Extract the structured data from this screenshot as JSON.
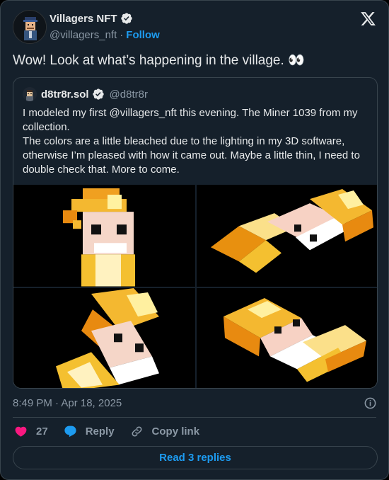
{
  "author": {
    "name": "Villagers NFT",
    "handle": "@villagers_nft",
    "separator": "·",
    "follow_label": "Follow"
  },
  "tweet": {
    "text": "Wow! Look at what’s happening in the village. 👀",
    "timestamp": "8:49 PM · Apr 18, 2025"
  },
  "quoted": {
    "name": "d8tr8r.sol",
    "handle": "@d8tr8r",
    "text": "I modeled my first @villagers_nft this evening. The Miner 1039 from my collection.\nThe colors are a little bleached due to the lighting in my 3D software, otherwise I’m pleased with how it came out. Maybe a little thin, I need to double check that. More to come."
  },
  "actions": {
    "likes": "27",
    "reply_label": "Reply",
    "copy_label": "Copy link"
  },
  "replies_button": "Read 3 replies",
  "colors": {
    "background": "#15202b",
    "border": "#38444d",
    "accent": "#1d9bf0",
    "like": "#f91880",
    "muted": "#8b98a5"
  },
  "icons": [
    "verified-badge-icon",
    "x-logo-icon",
    "info-icon",
    "heart-icon",
    "reply-bubble-icon",
    "link-icon"
  ]
}
